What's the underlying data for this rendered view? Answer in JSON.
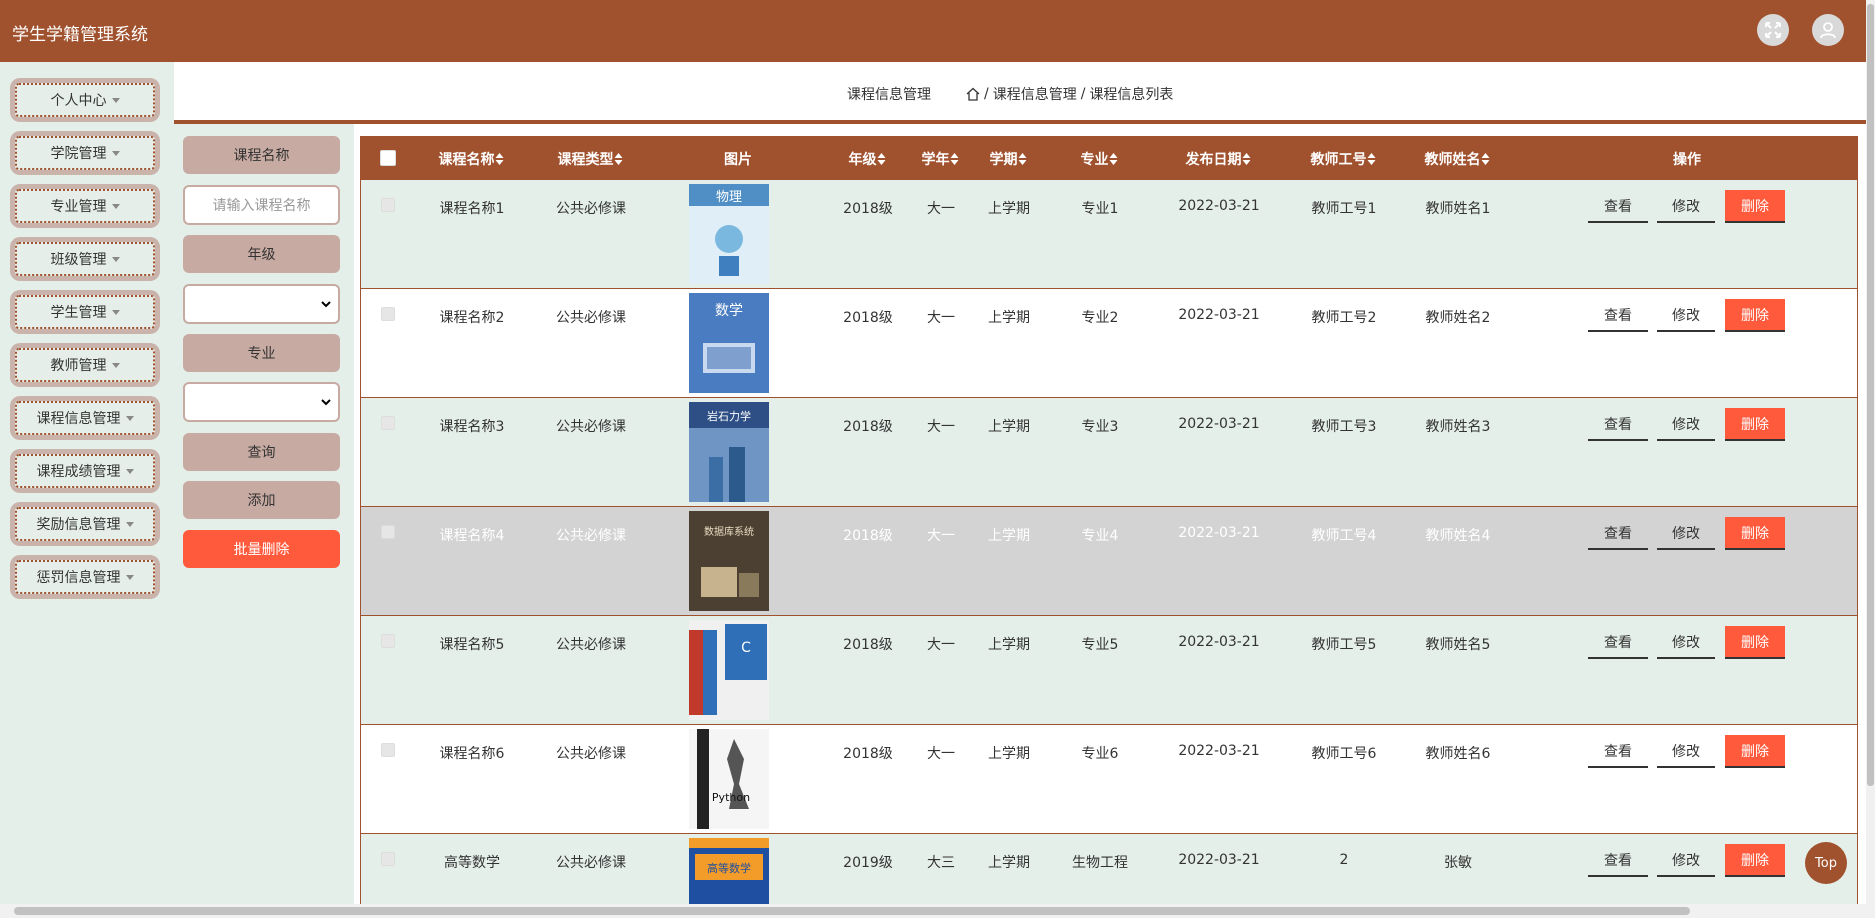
{
  "header": {
    "title": "学生学籍管理系统",
    "icons": [
      "fullscreen-icon",
      "user-icon"
    ]
  },
  "sidebar": {
    "items": [
      {
        "label": "个人中心"
      },
      {
        "label": "学院管理"
      },
      {
        "label": "专业管理"
      },
      {
        "label": "班级管理"
      },
      {
        "label": "学生管理"
      },
      {
        "label": "教师管理"
      },
      {
        "label": "课程信息管理"
      },
      {
        "label": "课程成绩管理"
      },
      {
        "label": "奖励信息管理"
      },
      {
        "label": "惩罚信息管理"
      }
    ]
  },
  "breadcrumb": {
    "page_title": "课程信息管理",
    "path": [
      "课程信息管理",
      "课程信息列表"
    ],
    "separator": "/"
  },
  "search": {
    "course_name_label": "课程名称",
    "course_name_placeholder": "请输入课程名称",
    "grade_label": "年级",
    "major_label": "专业",
    "query_label": "查询",
    "add_label": "添加",
    "batch_delete_label": "批量删除"
  },
  "table": {
    "columns": [
      "课程名称",
      "课程类型",
      "图片",
      "年级",
      "学年",
      "学期",
      "专业",
      "发布日期",
      "教师工号",
      "教师姓名",
      "操作"
    ],
    "actions": {
      "view": "查看",
      "edit": "修改",
      "delete": "删除"
    },
    "rows": [
      {
        "course": "课程名称1",
        "type": "公共必修课",
        "grade": "2018级",
        "year": "大一",
        "term": "上学期",
        "major": "专业1",
        "date": "2022-03-21",
        "tid": "教师工号1",
        "tname": "教师姓名1",
        "book": "物理"
      },
      {
        "course": "课程名称2",
        "type": "公共必修课",
        "grade": "2018级",
        "year": "大一",
        "term": "上学期",
        "major": "专业2",
        "date": "2022-03-21",
        "tid": "教师工号2",
        "tname": "教师姓名2",
        "book": "数学"
      },
      {
        "course": "课程名称3",
        "type": "公共必修课",
        "grade": "2018级",
        "year": "大一",
        "term": "上学期",
        "major": "专业3",
        "date": "2022-03-21",
        "tid": "教师工号3",
        "tname": "教师姓名3",
        "book": "岩石力学"
      },
      {
        "course": "课程名称4",
        "type": "公共必修课",
        "grade": "2018级",
        "year": "大一",
        "term": "上学期",
        "major": "专业4",
        "date": "2022-03-21",
        "tid": "教师工号4",
        "tname": "教师姓名4",
        "book": "数据库系统"
      },
      {
        "course": "课程名称5",
        "type": "公共必修课",
        "grade": "2018级",
        "year": "大一",
        "term": "上学期",
        "major": "专业5",
        "date": "2022-03-21",
        "tid": "教师工号5",
        "tname": "教师姓名5",
        "book": "C语言"
      },
      {
        "course": "课程名称6",
        "type": "公共必修课",
        "grade": "2018级",
        "year": "大一",
        "term": "上学期",
        "major": "专业6",
        "date": "2022-03-21",
        "tid": "教师工号6",
        "tname": "教师姓名6",
        "book": "Python"
      },
      {
        "course": "高等数学",
        "type": "公共必修课",
        "grade": "2019级",
        "year": "大三",
        "term": "上学期",
        "major": "生物工程",
        "date": "2022-03-21",
        "tid": "2",
        "tname": "张敏",
        "book": "高等数学"
      }
    ]
  },
  "top_button": "Top",
  "colors": {
    "brand": "#a0512d",
    "danger": "#ff5a3c",
    "panel": "#e4efea",
    "tan": "#c7aaa2"
  }
}
